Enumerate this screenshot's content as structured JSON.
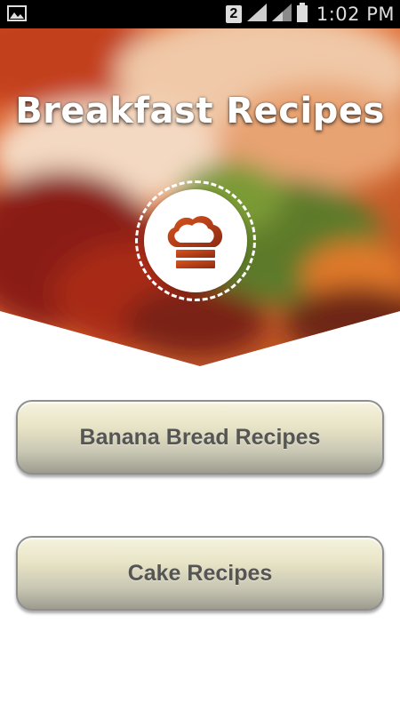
{
  "status_bar": {
    "sim_slot": "2",
    "time": "1:02 PM",
    "icons": [
      "gallery-notification-icon",
      "sim-badge",
      "signal-icon",
      "signal-icon-secondary",
      "battery-icon"
    ]
  },
  "header": {
    "title": "Breakfast Recipes",
    "logo_icon": "chef-hat-icon"
  },
  "menu": {
    "items": [
      {
        "label": "Banana Bread Recipes"
      },
      {
        "label": "Cake Recipes"
      }
    ]
  },
  "colors": {
    "button_top": "#f6f3df",
    "button_bottom": "#9d9c8f",
    "button_text": "#555553",
    "logo_accent": "#c24a1c"
  }
}
